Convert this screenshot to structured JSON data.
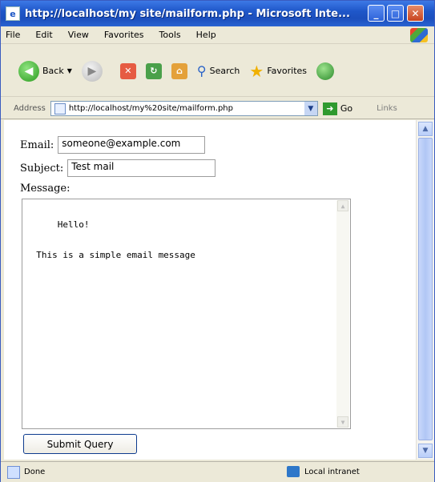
{
  "window": {
    "title": "http://localhost/my site/mailform.php - Microsoft Inte...",
    "min_label": "_",
    "max_label": "□",
    "close_label": "✕"
  },
  "menu": [
    "File",
    "Edit",
    "View",
    "Favorites",
    "Tools",
    "Help"
  ],
  "toolbar": {
    "back_label": "Back",
    "search_label": "Search",
    "favorites_label": "Favorites"
  },
  "address": {
    "label": "Address",
    "url": "http://localhost/my%20site/mailform.php",
    "go_label": "Go",
    "links_label": "Links"
  },
  "form": {
    "email_label": "Email:",
    "email_value": "someone@example.com",
    "subject_label": "Subject:",
    "subject_value": "Test mail",
    "message_label": "Message:",
    "message_value": "Hello!\n\n  This is a simple email message",
    "submit_label": "Submit Query"
  },
  "status": {
    "text": "Done",
    "zone": "Local intranet"
  }
}
